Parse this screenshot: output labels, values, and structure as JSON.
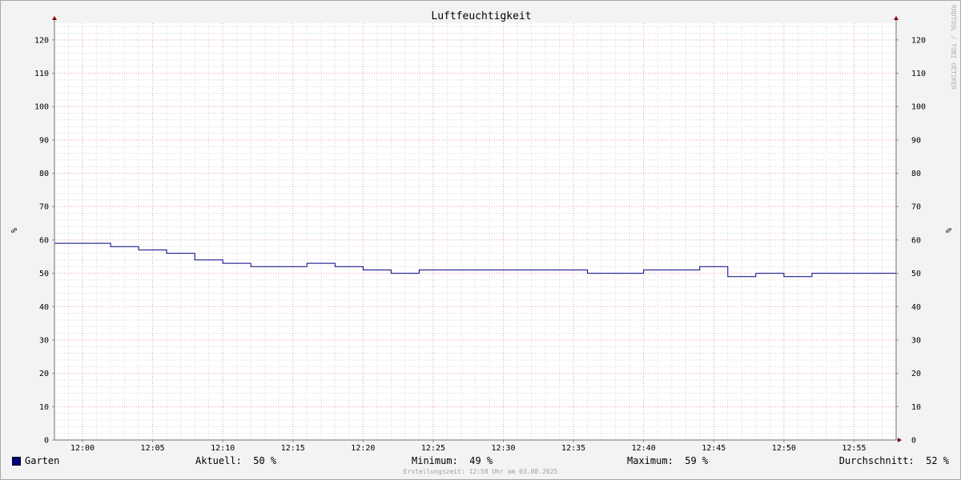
{
  "chart_data": {
    "type": "line",
    "title": "Luftfeuchtigkeit",
    "ylabel": "%",
    "ylim": [
      0,
      125
    ],
    "yticks": [
      0,
      10,
      20,
      30,
      40,
      50,
      60,
      70,
      80,
      90,
      100,
      110,
      120
    ],
    "xtick_labels": [
      "12:00",
      "12:05",
      "12:10",
      "12:15",
      "12:20",
      "12:25",
      "12:30",
      "12:35",
      "12:40",
      "12:45",
      "12:50",
      "12:55"
    ],
    "x_unit": "time",
    "grid": true,
    "series": [
      {
        "name": "Garten",
        "color": "#000080",
        "steps": [
          {
            "from": "11:58",
            "to": "12:02",
            "value": 59
          },
          {
            "from": "12:02",
            "to": "12:04",
            "value": 58
          },
          {
            "from": "12:04",
            "to": "12:06",
            "value": 57
          },
          {
            "from": "12:06",
            "to": "12:08",
            "value": 56
          },
          {
            "from": "12:08",
            "to": "12:10",
            "value": 54
          },
          {
            "from": "12:10",
            "to": "12:12",
            "value": 53
          },
          {
            "from": "12:12",
            "to": "12:16",
            "value": 52
          },
          {
            "from": "12:16",
            "to": "12:18",
            "value": 53
          },
          {
            "from": "12:18",
            "to": "12:20",
            "value": 52
          },
          {
            "from": "12:20",
            "to": "12:22",
            "value": 51
          },
          {
            "from": "12:22",
            "to": "12:24",
            "value": 50
          },
          {
            "from": "12:24",
            "to": "12:36",
            "value": 51
          },
          {
            "from": "12:36",
            "to": "12:40",
            "value": 50
          },
          {
            "from": "12:40",
            "to": "12:44",
            "value": 51
          },
          {
            "from": "12:44",
            "to": "12:46",
            "value": 52
          },
          {
            "from": "12:46",
            "to": "12:48",
            "value": 49
          },
          {
            "from": "12:48",
            "to": "12:50",
            "value": 50
          },
          {
            "from": "12:50",
            "to": "12:52",
            "value": 49
          },
          {
            "from": "12:52",
            "to": "12:58",
            "value": 50
          }
        ]
      }
    ],
    "watermark": "RRDTOOL / TOBI OETIKER"
  },
  "legend": {
    "series_name": "Garten",
    "series_color": "#000080",
    "current": "Aktuell:  50 %",
    "minimum": "Minimum:  49 %",
    "maximum": "Maximum:  59 %",
    "average": "Durchschnitt:  52 %"
  },
  "footer": "Erstellungszeit: 12:58 Uhr am 03.08.2025"
}
